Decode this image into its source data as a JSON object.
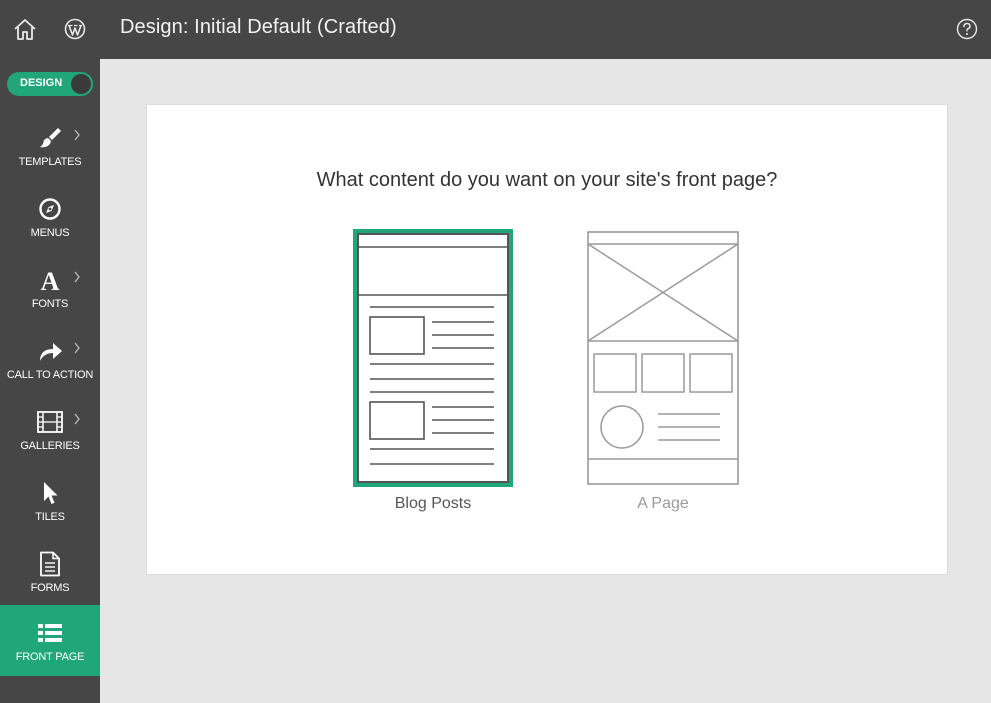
{
  "header": {
    "title": "Design: Initial Default (Crafted)",
    "home_icon": "home-icon",
    "wp_icon": "wordpress-icon",
    "help_icon": "help-icon"
  },
  "sidebar": {
    "toggle_label": "DESIGN",
    "toggle_on": true,
    "items": [
      {
        "label": "TEMPLATES",
        "icon": "paintbrush-icon",
        "has_submenu": true
      },
      {
        "label": "MENUS",
        "icon": "compass-icon",
        "has_submenu": false
      },
      {
        "label": "FONTS",
        "icon": "font-icon",
        "has_submenu": true
      },
      {
        "label": "CALL TO ACTION",
        "icon": "share-arrow-icon",
        "has_submenu": true
      },
      {
        "label": "GALLERIES",
        "icon": "film-icon",
        "has_submenu": true
      },
      {
        "label": "TILES",
        "icon": "cursor-icon",
        "has_submenu": false
      },
      {
        "label": "FORMS",
        "icon": "document-icon",
        "has_submenu": false
      },
      {
        "label": "FRONT PAGE",
        "icon": "list-icon",
        "has_submenu": false,
        "active": true
      }
    ]
  },
  "main": {
    "question": "What content do you want on your site's front page?",
    "options": [
      {
        "label": "Blog Posts",
        "selected": true
      },
      {
        "label": "A Page",
        "selected": false
      }
    ]
  },
  "colors": {
    "accent": "#21a67a",
    "topbar": "#464646",
    "background": "#e6e6e6"
  }
}
